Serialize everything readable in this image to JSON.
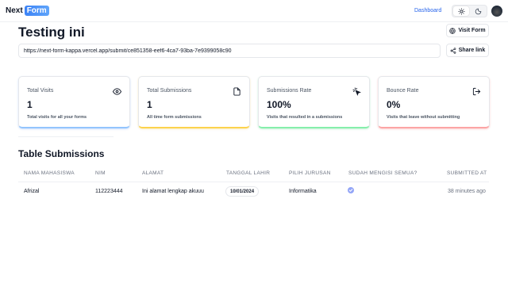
{
  "header": {
    "logo_prefix": "Next",
    "logo_badge": "Form",
    "nav_dashboard": "Dashboard",
    "theme": {
      "light_icon": "sun-icon",
      "dark_icon": "moon-icon",
      "active": "light"
    }
  },
  "page": {
    "title": "Testing ini",
    "visit_button": "Visit Form",
    "share_button": "Share link",
    "share_url": "https://next-form-kappa.vercel.app/submit/ce851358-eef6-4ca7-93ba-7e9399058c90"
  },
  "stats": [
    {
      "label": "Total Visits",
      "value": "1",
      "help": "Total visits for all your forms",
      "icon": "eye-icon",
      "accent": "#93c5fd"
    },
    {
      "label": "Total Submissions",
      "value": "1",
      "help": "All time form submissions",
      "icon": "file-icon",
      "accent": "#fcd34d"
    },
    {
      "label": "Submissions Rate",
      "value": "100%",
      "help": "Visits that resulted in a submissions",
      "icon": "cursor-click-icon",
      "accent": "#86efac"
    },
    {
      "label": "Bounce Rate",
      "value": "0%",
      "help": "Visits that leave without submitting",
      "icon": "exit-icon",
      "accent": "#fca5a5"
    }
  ],
  "table": {
    "title": "Table Submissions",
    "columns": [
      "NAMA MAHASISWA",
      "NIM",
      "ALAMAT",
      "TANGGAL LAHIR",
      "PILIH JURUSAN",
      "SUDAH MENGISI SEMUA?",
      "SUBMITTED AT"
    ],
    "rows": [
      {
        "nama": "Afrizal",
        "nim": "112223444",
        "alamat": "Ini alamat lengkap akuuu",
        "tanggal": "10/01/2024",
        "jurusan": "Informatika",
        "sudah": true,
        "submitted": "38 minutes ago"
      }
    ]
  }
}
